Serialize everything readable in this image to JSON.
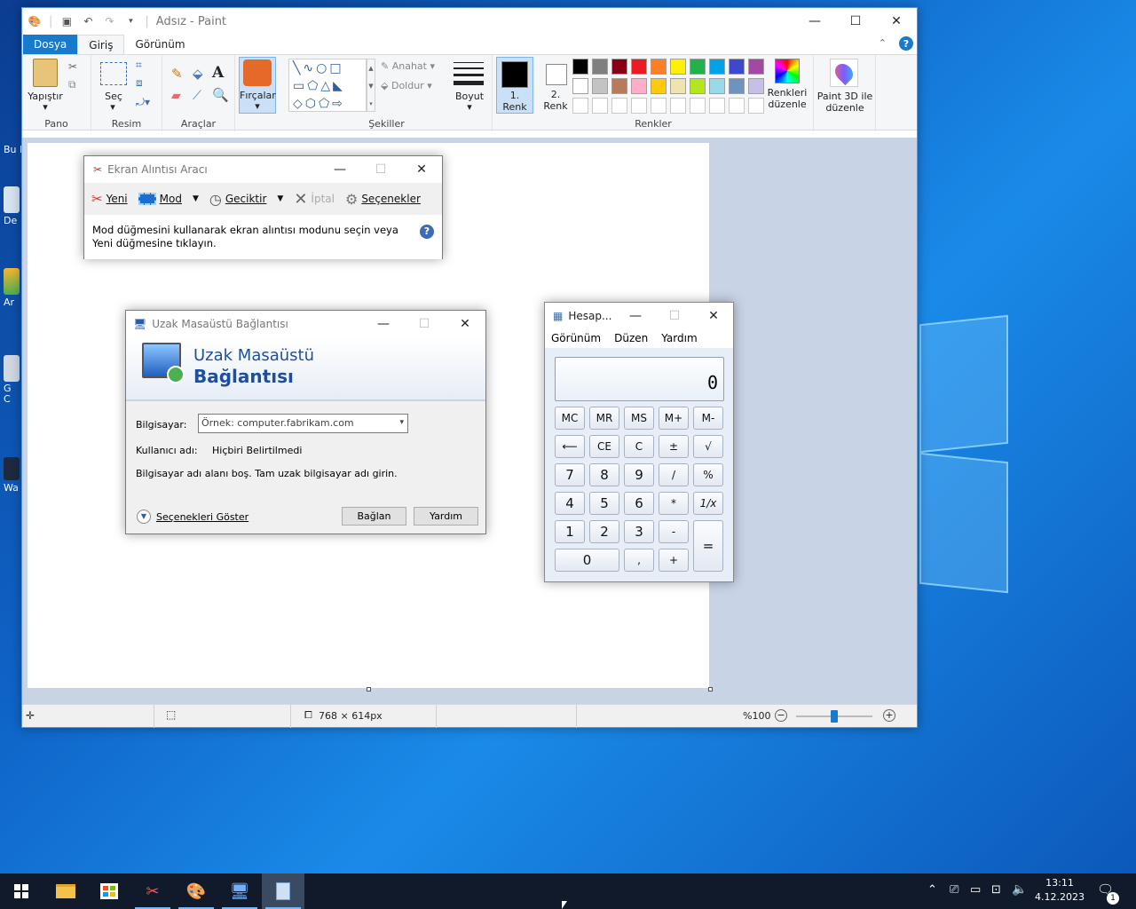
{
  "desktop": {
    "icons": [
      {
        "label": "Bu b"
      },
      {
        "label": "De"
      },
      {
        "label": "Ar"
      },
      {
        "label": "G\nC"
      },
      {
        "label": "Wa"
      }
    ]
  },
  "paint": {
    "title": "Adsız - Paint",
    "tabs": {
      "file": "Dosya",
      "home": "Giriş",
      "view": "Görünüm"
    },
    "groups": {
      "clipboard": {
        "label": "Pano",
        "paste": "Yapıştır"
      },
      "image": {
        "label": "Resim",
        "select": "Seç"
      },
      "tools": {
        "label": "Araçlar"
      },
      "brushes": {
        "label": "Fırçalar"
      },
      "shapes": {
        "label": "Şekiller",
        "outline": "Anahat",
        "fill": "Doldur"
      },
      "size": {
        "label": "Boyut"
      },
      "colors": {
        "label": "Renkler",
        "color1": "1.\nRenk",
        "color2": "2.\nRenk",
        "edit": "Renkleri düzenle",
        "palette_row1": [
          "#000000",
          "#7f7f7f",
          "#880015",
          "#ed1c24",
          "#ff7f27",
          "#fff200",
          "#22b14c",
          "#00a2e8",
          "#3f48cc",
          "#a349a4"
        ],
        "palette_row2": [
          "#ffffff",
          "#c3c3c3",
          "#b97a57",
          "#ffaec9",
          "#ffc90e",
          "#efe4b0",
          "#b5e61d",
          "#99d9ea",
          "#7092be",
          "#c8bfe7"
        ]
      },
      "paint3d": {
        "label": "Paint 3D ile düzenle"
      }
    },
    "status": {
      "size": "768 × 614px",
      "zoom": "%100",
      "zoom_fraction": 0.5
    }
  },
  "snip": {
    "title": "Ekran Alıntısı Aracı",
    "new": "Yeni",
    "mode": "Mod",
    "delay": "Geciktir",
    "cancel": "İptal",
    "options": "Seçenekler",
    "message": "Mod düğmesini kullanarak ekran alıntısı modunu seçin veya Yeni düğmesine tıklayın."
  },
  "rdp": {
    "title": "Uzak Masaüstü Bağlantısı",
    "banner_line1": "Uzak Masaüstü",
    "banner_line2": "Bağlantısı",
    "computer_label": "Bilgisayar:",
    "computer_value": "Örnek: computer.fabrikam.com",
    "user_label": "Kullanıcı adı:",
    "user_value": "Hiçbiri Belirtilmedi",
    "hint": "Bilgisayar adı alanı boş. Tam uzak bilgisayar adı girin.",
    "show_options": "Seçenekleri Göster",
    "connect": "Bağlan",
    "help": "Yardım"
  },
  "calc": {
    "title": "Hesap...",
    "menu": [
      "Görünüm",
      "Düzen",
      "Yardım"
    ],
    "display": "0",
    "buttons": {
      "mc": "MC",
      "mr": "MR",
      "ms": "MS",
      "mplus": "M+",
      "mminus": "M-",
      "back": "⟵",
      "ce": "CE",
      "c": "C",
      "pm": "±",
      "sqrt": "√",
      "n7": "7",
      "n8": "8",
      "n9": "9",
      "div": "/",
      "pct": "%",
      "n4": "4",
      "n5": "5",
      "n6": "6",
      "mul": "*",
      "inv": "1/x",
      "n1": "1",
      "n2": "2",
      "n3": "3",
      "sub": "-",
      "eq": "=",
      "n0": "0",
      "dot": ",",
      "add": "+"
    }
  },
  "taskbar": {
    "time": "13:11",
    "date": "4.12.2023",
    "notif_count": "1"
  }
}
